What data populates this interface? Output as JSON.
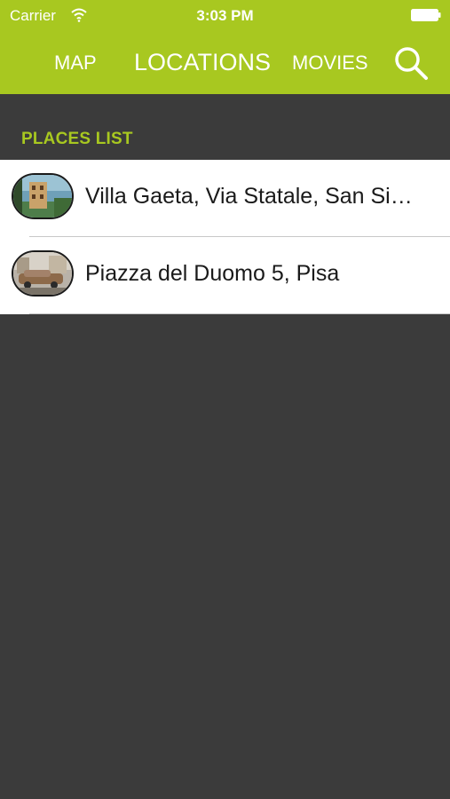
{
  "status_bar": {
    "carrier": "Carrier",
    "time": "3:03 PM"
  },
  "nav": {
    "map": "MAP",
    "locations": "LOCATIONS",
    "movies": "MOVIES"
  },
  "section": {
    "title": "PLACES LIST"
  },
  "places": [
    {
      "label": "Villa Gaeta, Via Statale, San Si…",
      "icon": "villa-thumbnail"
    },
    {
      "label": "Piazza del Duomo 5, Pisa",
      "icon": "piazza-thumbnail"
    }
  ],
  "colors": {
    "accent": "#a8c820",
    "background": "#3b3b3b",
    "list_bg": "#ffffff",
    "text": "#1a1a1a"
  }
}
